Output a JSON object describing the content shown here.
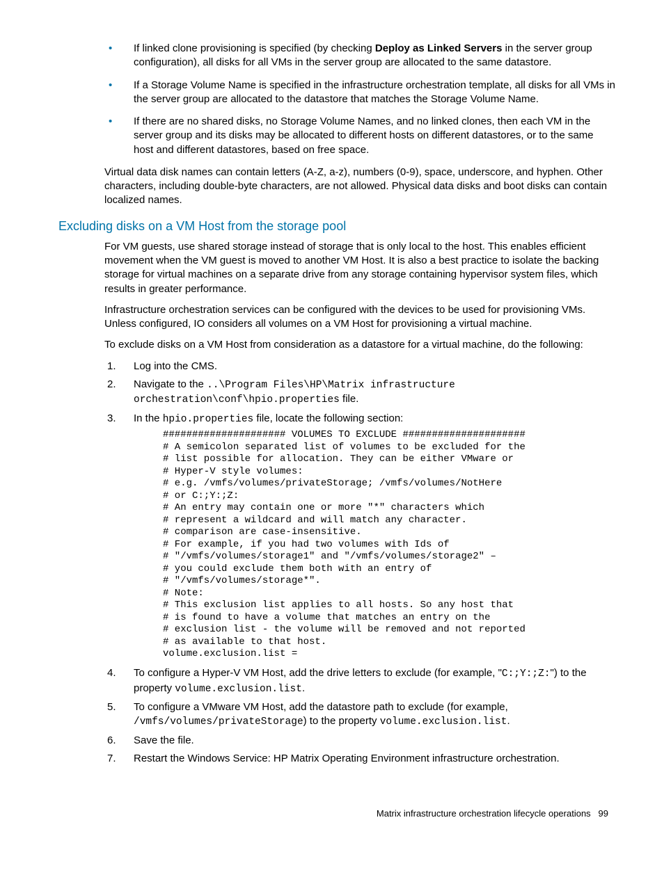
{
  "bullets": [
    {
      "pre": "If linked clone provisioning is specified (by checking ",
      "bold": "Deploy as Linked Servers",
      "post": " in the server group configuration), all disks for all VMs in the server group are allocated to the same datastore."
    },
    {
      "pre": "If a Storage Volume Name is specified in the infrastructure orchestration template, all disks for all VMs in the server group are allocated to the datastore that matches the Storage Volume Name.",
      "bold": "",
      "post": ""
    },
    {
      "pre": "If there are no shared disks, no Storage Volume Names, and no linked clones, then each VM in the server group and its disks may be allocated to different hosts on different datastores, or to the same host and different datastores, based on free space.",
      "bold": "",
      "post": ""
    }
  ],
  "para_after_bullets": "Virtual data disk names can contain letters (A-Z, a-z), numbers (0-9), space, underscore, and hyphen. Other characters, including double-byte characters, are not allowed. Physical data disks and boot disks can contain localized names.",
  "section_heading": "Excluding disks on a VM Host from the storage pool",
  "para1": "For VM guests, use shared storage instead of storage that is only local to the host. This enables efficient movement when the VM guest is moved to another VM Host. It is also a best practice to isolate the backing storage for virtual machines on a separate drive from any storage containing hypervisor system files, which results in greater performance.",
  "para2": "Infrastructure orchestration services can be configured with the devices to be used for provisioning VMs. Unless configured, IO considers all volumes on a VM Host for provisioning a virtual machine.",
  "para3": "To exclude disks on a VM Host from consideration as a datastore for a virtual machine, do the following:",
  "steps": {
    "s1": "Log into the CMS.",
    "s2_pre": "Navigate to the ",
    "s2_code": "..\\Program Files\\HP\\Matrix infrastructure orchestration\\conf\\hpio.properties",
    "s2_post": " file.",
    "s3_pre": "In the ",
    "s3_code": "hpio.properties",
    "s3_post": " file, locate the following section:",
    "s3_block": "##################### VOLUMES TO EXCLUDE #####################\n# A semicolon separated list of volumes to be excluded for the\n# list possible for allocation. They can be either VMware or\n# Hyper-V style volumes:\n# e.g. /vmfs/volumes/privateStorage; /vmfs/volumes/NotHere\n# or C:;Y:;Z:\n# An entry may contain one or more \"*\" characters which\n# represent a wildcard and will match any character.\n# comparison are case-insensitive.\n# For example, if you had two volumes with Ids of\n# \"/vmfs/volumes/storage1\" and \"/vmfs/volumes/storage2\" –\n# you could exclude them both with an entry of\n# \"/vmfs/volumes/storage*\".\n# Note:\n# This exclusion list applies to all hosts. So any host that\n# is found to have a volume that matches an entry on the\n# exclusion list - the volume will be removed and not reported\n# as available to that host.\nvolume.exclusion.list =",
    "s4_pre": "To configure a Hyper-V VM Host, add the drive letters to exclude (for example, \"",
    "s4_code1": "C:;Y:;Z:",
    "s4_mid": "\") to the property ",
    "s4_code2": "volume.exclusion.list",
    "s4_post": ".",
    "s5_pre": "To configure a VMware VM Host, add the datastore path to exclude (for example, ",
    "s5_code1": "/vmfs/volumes/privateStorage",
    "s5_mid": ") to the property ",
    "s5_code2": "volume.exclusion.list",
    "s5_post": ".",
    "s6": "Save the file.",
    "s7": "Restart the Windows Service: HP Matrix Operating Environment infrastructure orchestration."
  },
  "footer_text": "Matrix infrastructure orchestration lifecycle operations",
  "footer_page": "99"
}
